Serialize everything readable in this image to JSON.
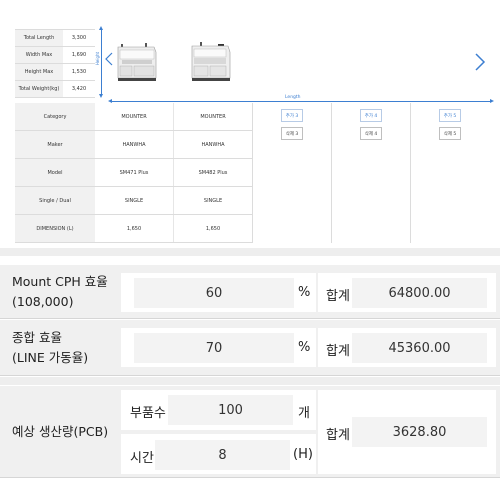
{
  "summary": {
    "rows": [
      {
        "label": "Total Length",
        "value": "3,300"
      },
      {
        "label": "Width Max",
        "value": "1,690"
      },
      {
        "label": "Height Max",
        "value": "1,530"
      },
      {
        "label": "Total Weight(kg)",
        "value": "3,420"
      }
    ],
    "height_label": "Height",
    "length_label": "Length"
  },
  "spec": {
    "labels": [
      "Category",
      "Maker",
      "Model",
      "Single / Dual",
      "DIMENSION (L)"
    ],
    "machines": [
      {
        "category": "MOUNTER",
        "maker": "HANWHA",
        "model": "SM471 Plus",
        "single_dual": "SINGLE",
        "dimension": "1,650"
      },
      {
        "category": "MOUNTER",
        "maker": "HANWHA",
        "model": "SM482 Plus",
        "single_dual": "SINGLE",
        "dimension": "1,650"
      }
    ],
    "slots": [
      {
        "add": "추가 3",
        "del": "삭제 3"
      },
      {
        "add": "추가 4",
        "del": "삭제 4"
      },
      {
        "add": "추가 5",
        "del": "삭제 5"
      }
    ]
  },
  "calc": {
    "mount": {
      "label_line1": "Mount CPH 효율",
      "label_line2": "(108,000)",
      "value": "60",
      "unit": "%",
      "sum_label": "합계",
      "sum_value": "64800.00"
    },
    "total": {
      "label_line1": "종합 효율",
      "label_line2": "(LINE 가동율)",
      "value": "70",
      "unit": "%",
      "sum_label": "합계",
      "sum_value": "45360.00"
    },
    "production": {
      "label": "예상 생산량(PCB)",
      "parts_label": "부품수",
      "parts_value": "100",
      "parts_unit": "개",
      "time_label": "시간",
      "time_value": "8",
      "time_unit": "(H)",
      "sum_label": "합계",
      "sum_value": "3628.80"
    }
  },
  "colors": {
    "accent": "#3d7fd1",
    "header_bg": "#f1f1f1",
    "section_bg": "#f0f0f0"
  }
}
